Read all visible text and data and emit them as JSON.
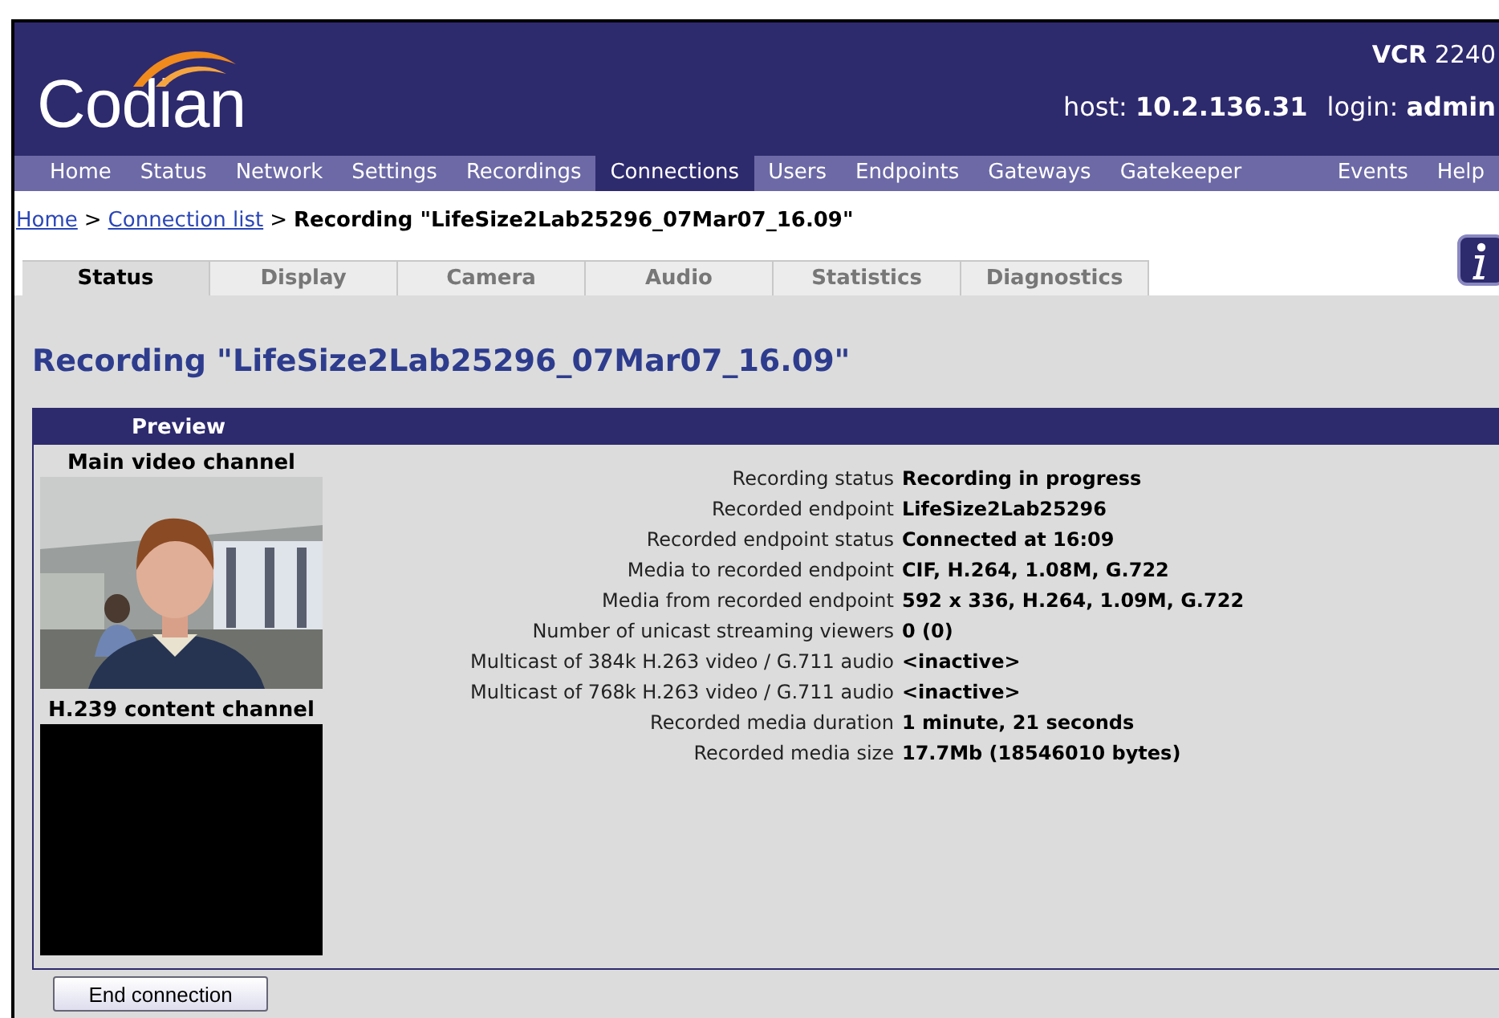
{
  "header": {
    "logo": "Codian",
    "product": {
      "name": "VCR",
      "model": "2240"
    },
    "host_label": "host:",
    "host": "10.2.136.31",
    "login_label": "login:",
    "login": "admin"
  },
  "nav": {
    "left": [
      {
        "label": "Home",
        "selected": false
      },
      {
        "label": "Status",
        "selected": false
      },
      {
        "label": "Network",
        "selected": false
      },
      {
        "label": "Settings",
        "selected": false
      },
      {
        "label": "Recordings",
        "selected": false
      },
      {
        "label": "Connections",
        "selected": true
      },
      {
        "label": "Users",
        "selected": false
      },
      {
        "label": "Endpoints",
        "selected": false
      },
      {
        "label": "Gateways",
        "selected": false
      },
      {
        "label": "Gatekeeper",
        "selected": false
      }
    ],
    "right": [
      {
        "label": "Events",
        "selected": false
      },
      {
        "label": "Help",
        "selected": false
      }
    ]
  },
  "breadcrumb": {
    "links": [
      "Home",
      "Connection list"
    ],
    "separator": ">",
    "current": "Recording \"LifeSize2Lab25296_07Mar07_16.09\""
  },
  "tabs": [
    {
      "label": "Status",
      "selected": true
    },
    {
      "label": "Display",
      "selected": false
    },
    {
      "label": "Camera",
      "selected": false
    },
    {
      "label": "Audio",
      "selected": false
    },
    {
      "label": "Statistics",
      "selected": false
    },
    {
      "label": "Diagnostics",
      "selected": false
    }
  ],
  "title": "Recording \"LifeSize2Lab25296_07Mar07_16.09\"",
  "preview": {
    "heading": "Preview",
    "channels": [
      {
        "label": "Main video channel",
        "kind": "picture"
      },
      {
        "label": "H.239 content channel",
        "kind": "blank"
      }
    ]
  },
  "details": [
    {
      "label": "Recording status",
      "value": "Recording in progress"
    },
    {
      "label": "Recorded endpoint",
      "value": "LifeSize2Lab25296"
    },
    {
      "label": "Recorded endpoint status",
      "value": "Connected at 16:09"
    },
    {
      "label": "Media to recorded endpoint",
      "value": "CIF, H.264, 1.08M, G.722"
    },
    {
      "label": "Media from recorded endpoint",
      "value": "592 x 336, H.264, 1.09M, G.722"
    },
    {
      "label": "Number of unicast streaming viewers",
      "value": "0 (0)"
    },
    {
      "label": "Multicast of 384k H.263 video / G.711 audio",
      "value": "<inactive>"
    },
    {
      "label": "Multicast of 768k H.263 video / G.711 audio",
      "value": "<inactive>"
    },
    {
      "label": "Recorded media duration",
      "value": "1 minute, 21 seconds"
    },
    {
      "label": "Recorded media size",
      "value": "17.7Mb (18546010 bytes)"
    }
  ],
  "buttons": [
    "End connection"
  ]
}
